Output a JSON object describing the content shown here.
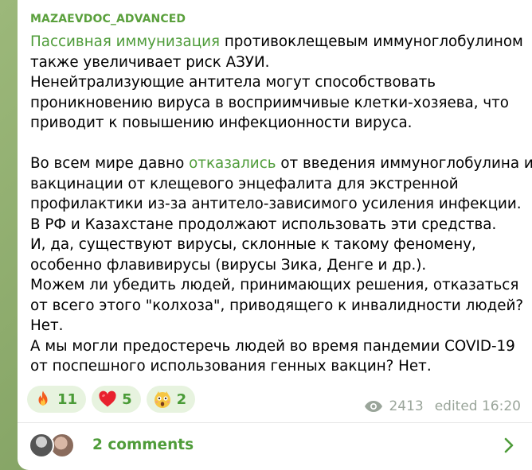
{
  "post": {
    "channel_name": "MAZAEVDOC_ADVANCED",
    "lines": [
      {
        "link": "Пассивная иммунизация",
        "rest": "  противоклещевым иммуноглобулином"
      },
      {
        "text": "также увеличивает риск АЗУИ."
      },
      {
        "text": "Ненейтрализующие антитела могут способствовать"
      },
      {
        "text": "проникновению вируса в восприимчивые клетки-хозяева, что"
      },
      {
        "text": "приводит к повышению инфекционности вируса."
      },
      {
        "text": ""
      },
      {
        "before": "Во всем мире давно ",
        "link": "отказались",
        "after": " от введения иммуноглобулина и"
      },
      {
        "text": "вакцинации от клещевого энцефалита для экстренной"
      },
      {
        "text": "профилактики из-за антитело-зависимого усиления инфекции."
      },
      {
        "text": "В РФ и Казахстане продолжают использовать эти средства."
      },
      {
        "text": "И, да, существуют вирусы, склонные к такому феномену,"
      },
      {
        "text": "особенно флавивирусы (вирусы Зика, Денге и др.)."
      },
      {
        "text": "Можем ли убедить людей, принимающих решения, отказаться"
      },
      {
        "text": "от всего этого \"колхоза\", приводящего к инвалидности людей?"
      },
      {
        "text": "Нет."
      },
      {
        "text": "А мы могли предостеречь людей во время пандемии COVID-19"
      },
      {
        "text": "от поспешного использования генных вакцин? Нет."
      }
    ]
  },
  "reactions": [
    {
      "icon": "fire-emoji-icon",
      "count": "11"
    },
    {
      "icon": "heart-emoji-icon",
      "count": "5"
    },
    {
      "icon": "shocked-face-emoji-icon",
      "count": "2"
    }
  ],
  "meta": {
    "views": "2413",
    "edited": "edited 16:20"
  },
  "comments": {
    "label": "2 comments"
  },
  "colors": {
    "accent": "#4f9c3a",
    "channel": "#5aa03c",
    "reaction_bg": "#e7f3df",
    "meta": "#9aa59a",
    "bubble": "#ffffff"
  }
}
